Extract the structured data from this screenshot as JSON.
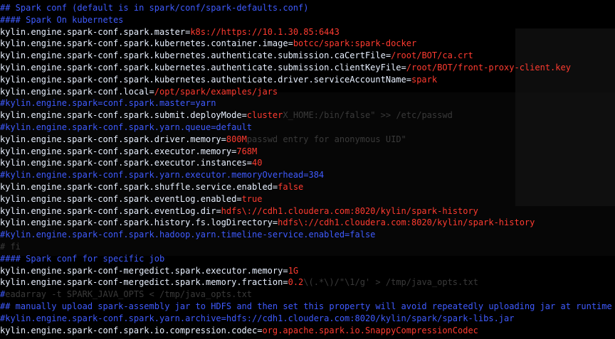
{
  "lines": [
    {
      "segments": [
        {
          "text": "## Spark conf (default is in spark/conf/spark-defaults.conf)",
          "cls": "c-comment"
        }
      ]
    },
    {
      "segments": [
        {
          "text": "#### Spark On kubernetes",
          "cls": "c-comment"
        }
      ]
    },
    {
      "segments": [
        {
          "text": "kylin.engine.spark-conf.spark.master",
          "cls": "c-key"
        },
        {
          "text": "=",
          "cls": "c-eq"
        },
        {
          "text": "k8s://https://10.1.30.85:6443",
          "cls": "c-val"
        }
      ]
    },
    {
      "segments": [
        {
          "text": "kylin.engine.spark-conf.spark.kubernetes.container.image",
          "cls": "c-key"
        },
        {
          "text": "=",
          "cls": "c-eq"
        },
        {
          "text": "botcc/spark:spark-docker",
          "cls": "c-val"
        }
      ]
    },
    {
      "segments": [
        {
          "text": "kylin.engine.spark-conf.spark.kubernetes.authenticate.submission.caCertFile",
          "cls": "c-key"
        },
        {
          "text": "=",
          "cls": "c-eq"
        },
        {
          "text": "/root/BOT/ca.crt",
          "cls": "c-val"
        }
      ]
    },
    {
      "segments": [
        {
          "text": "kylin.engine.spark-conf.spark.kubernetes.authenticate.submission.clientKeyFile",
          "cls": "c-key"
        },
        {
          "text": "=",
          "cls": "c-eq"
        },
        {
          "text": "/root/BOT/front-proxy-client.key",
          "cls": "c-val"
        }
      ]
    },
    {
      "segments": [
        {
          "text": "kylin.engine.spark-conf.spark.kubernetes.authenticate.driver.serviceAccountName",
          "cls": "c-key"
        },
        {
          "text": "=",
          "cls": "c-eq"
        },
        {
          "text": "spark",
          "cls": "c-val"
        }
      ]
    },
    {
      "segments": [
        {
          "text": "kylin.engine.spark-conf.local",
          "cls": "c-key"
        },
        {
          "text": "=",
          "cls": "c-eq"
        },
        {
          "text": "/opt/spark/examples/jars",
          "cls": "c-val"
        }
      ]
    },
    {
      "segments": [
        {
          "text": "#kylin.engine.spark=conf.spark.master=yarn",
          "cls": "c-comment"
        }
      ]
    },
    {
      "segments": [
        {
          "text": "kylin.engine.spark-conf.spark.submit.deployMode",
          "cls": "c-key"
        },
        {
          "text": "=",
          "cls": "c-eq"
        },
        {
          "text": "cluster",
          "cls": "c-val"
        },
        {
          "text": "X_HOME:/bin/false\" >> /etc/passwd",
          "cls": "c-ghost"
        }
      ]
    },
    {
      "segments": [
        {
          "text": "#kylin.engine.spark-conf.spark.yarn.queue=default",
          "cls": "c-comment"
        }
      ]
    },
    {
      "segments": [
        {
          "text": "kylin.engine.spark-conf.spark.driver.memory",
          "cls": "c-key"
        },
        {
          "text": "=",
          "cls": "c-eq"
        },
        {
          "text": "800M",
          "cls": "c-val"
        },
        {
          "text": "passwd entry for anonymous UID\"",
          "cls": "c-ghost"
        }
      ]
    },
    {
      "segments": [
        {
          "text": "kylin.engine.spark-conf.spark.executor.memory",
          "cls": "c-key"
        },
        {
          "text": "=",
          "cls": "c-eq"
        },
        {
          "text": "768M",
          "cls": "c-val"
        }
      ]
    },
    {
      "segments": [
        {
          "text": "kylin.engine.spark-conf.spark.executor.instances",
          "cls": "c-key"
        },
        {
          "text": "=",
          "cls": "c-eq"
        },
        {
          "text": "40",
          "cls": "c-val"
        }
      ]
    },
    {
      "segments": [
        {
          "text": "#kylin.engine.spark-conf.spark.yarn.executor.memoryOverhead=384",
          "cls": "c-comment"
        }
      ]
    },
    {
      "segments": [
        {
          "text": "kylin.engine.spark-conf.spark.shuffle.service.enabled",
          "cls": "c-key"
        },
        {
          "text": "=",
          "cls": "c-eq"
        },
        {
          "text": "false",
          "cls": "c-val"
        }
      ]
    },
    {
      "segments": [
        {
          "text": "kylin.engine.spark-conf.spark.eventLog.enabled",
          "cls": "c-key"
        },
        {
          "text": "=",
          "cls": "c-eq"
        },
        {
          "text": "true",
          "cls": "c-val"
        }
      ]
    },
    {
      "segments": [
        {
          "text": "kylin.engine.spark-conf.spark.eventLog.dir",
          "cls": "c-key"
        },
        {
          "text": "=",
          "cls": "c-eq"
        },
        {
          "text": "hdfs\\://cdh1.cloudera.com:8020/kylin/spark-history",
          "cls": "c-val"
        }
      ]
    },
    {
      "segments": [
        {
          "text": "kylin.engine.spark-conf.spark.history.fs.logDirectory",
          "cls": "c-key"
        },
        {
          "text": "=",
          "cls": "c-eq"
        },
        {
          "text": "hdfs\\://cdh1.cloudera.com:8020/kylin/spark-history",
          "cls": "c-val"
        }
      ]
    },
    {
      "segments": [
        {
          "text": "#kylin.engine.spark-conf.spark.hadoop.yarn.timeline-service.enabled=false",
          "cls": "c-comment"
        }
      ]
    },
    {
      "segments": [
        {
          "text": "# fi",
          "cls": "c-ghost"
        }
      ]
    },
    {
      "segments": [
        {
          "text": "#### Spark conf for specific job",
          "cls": "c-comment"
        }
      ]
    },
    {
      "segments": [
        {
          "text": "kylin.engine.spark-conf-mergedict.spark.executor.memory",
          "cls": "c-key"
        },
        {
          "text": "=",
          "cls": "c-eq"
        },
        {
          "text": "1G",
          "cls": "c-val"
        }
      ]
    },
    {
      "segments": [
        {
          "text": "kylin.engine.spark-conf-mergedict.spark.memory.fraction",
          "cls": "c-key"
        },
        {
          "text": "=",
          "cls": "c-eq"
        },
        {
          "text": "0.2",
          "cls": "c-val"
        },
        {
          "text": "\\(.*\\)/\"\\1/g' > /tmp/java_opts.txt",
          "cls": "c-ghost"
        }
      ]
    },
    {
      "segments": [
        {
          "text": "#",
          "cls": "c-comment"
        },
        {
          "text": "eadarray -t SPARK_JAVA_OPTS < /tmp/java_opts.txt",
          "cls": "c-ghost"
        }
      ]
    },
    {
      "segments": [
        {
          "text": "## manually upload spark-assembly jar to HDFS and then set this property will avoid repeatedly uploading jar at runtime",
          "cls": "c-comment"
        }
      ]
    },
    {
      "segments": [
        {
          "text": "#kylin.engine.spark-conf.spark.yarn.archive=hdfs://cdh1.cloudera.com:8020/kylin/spark/spark-libs.jar",
          "cls": "c-comment"
        }
      ]
    },
    {
      "segments": [
        {
          "text": "kylin.engine.spark-conf.spark.io.compression.codec",
          "cls": "c-key"
        },
        {
          "text": "=",
          "cls": "c-eq"
        },
        {
          "text": "org.apache.spark.io.SnappyCompressionCodec",
          "cls": "c-val"
        }
      ]
    }
  ]
}
